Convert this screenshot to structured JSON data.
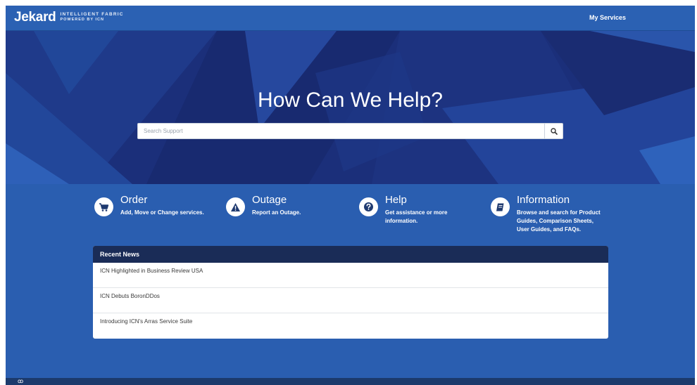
{
  "header": {
    "brand_name": "Jekard",
    "brand_tagline": "INTELLIGENT FABRIC",
    "brand_powered": "POWERED BY ICN",
    "nav_link": "My Services"
  },
  "hero": {
    "title": "How Can We Help?",
    "search_placeholder": "Search Support",
    "search_value": ""
  },
  "features": [
    {
      "title": "Order",
      "description": "Add, Move or Change services.",
      "icon": "cart-icon"
    },
    {
      "title": "Outage",
      "description": "Report an Outage.",
      "icon": "warning-icon"
    },
    {
      "title": "Help",
      "description": "Get assistance or more information.",
      "icon": "question-icon"
    },
    {
      "title": "Information",
      "description": "Browse and search for Product Guides, Comparison Sheets, User Guides, and FAQs.",
      "icon": "book-icon"
    }
  ],
  "news": {
    "header": "Recent News",
    "items": [
      "ICN Highlighted in Business Review USA",
      "ICN Debuts BoronDDos",
      "Introducing ICN's Arras Service Suite"
    ]
  },
  "footer": {
    "logo": "ꝏ"
  },
  "colors": {
    "topbar": "#2b61b3",
    "hero_dark": "#1b2f7a",
    "body_blue": "#2a5eb0",
    "news_header": "#1a2c57",
    "footer": "#1c3a6c"
  }
}
